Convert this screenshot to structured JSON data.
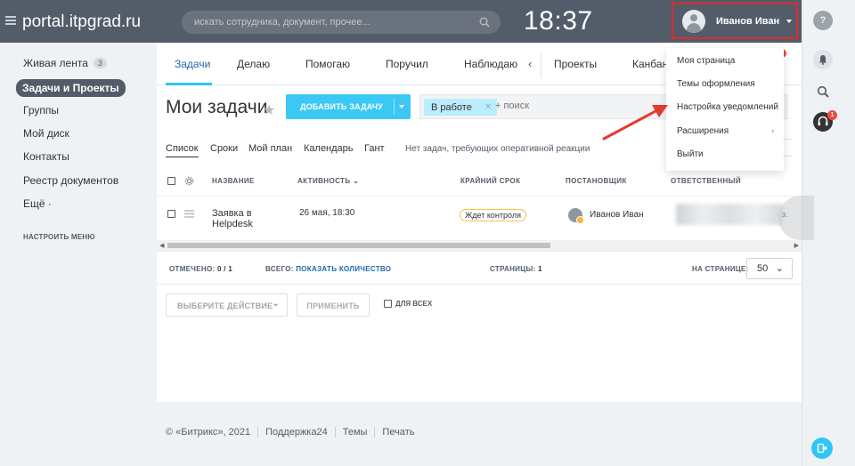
{
  "header": {
    "logo": "portal.itpgrad.ru",
    "search_placeholder": "искать сотрудника, документ, прочее...",
    "clock": "18:37",
    "user_name": "Иванов Иван"
  },
  "left_menu": {
    "items": [
      {
        "label": "Живая лента",
        "counter": "3"
      },
      {
        "label": "Задачи и Проекты"
      },
      {
        "label": "Группы"
      },
      {
        "label": "Мой диск"
      },
      {
        "label": "Контакты"
      },
      {
        "label": "Реестр документов"
      },
      {
        "label": "Ещё ·"
      }
    ],
    "settings": "НАСТРОИТЬ МЕНЮ"
  },
  "tabs": [
    "Задачи",
    "Делаю",
    "Помогаю",
    "Поручил",
    "Наблюдаю",
    "Проекты",
    "Канбан"
  ],
  "title": "Мои задачи",
  "add_button": "ДОБАВИТЬ ЗАДАЧУ",
  "filter": {
    "chip": "В работе",
    "placeholder": "+ поиск"
  },
  "subnav": {
    "items": [
      "Список",
      "Сроки",
      "Мой план",
      "Календарь",
      "Гант"
    ],
    "note": "Нет задач, требующих оперативной реакции"
  },
  "table": {
    "headers": {
      "name": "НАЗВАНИЕ",
      "activity": "АКТИВНОСТЬ",
      "deadline": "КРАЙНИЙ СРОК",
      "creator": "ПОСТАНОВЩИК",
      "responsible": "ОТВЕТСТВЕННЫЙ"
    },
    "rows": [
      {
        "name_line1": "Заявка в",
        "name_line2": "Helpdesk",
        "activity": "26 мая, 18:30",
        "status": "Ждет контроля",
        "creator": "Иванов Иван",
        "responsible_tail": "з."
      }
    ]
  },
  "footer_bar": {
    "marked_label": "ОТМЕЧЕНО:",
    "marked_value": "0 / 1",
    "total_label": "ВСЕГО:",
    "total_link": "ПОКАЗАТЬ КОЛИЧЕСТВО",
    "pages_label": "СТРАНИЦЫ:",
    "pages_value": "1",
    "per_page_label": "НА СТРАНИЦЕ:",
    "per_page_value": "50"
  },
  "actions": {
    "select": "ВЫБЕРИТЕ ДЕЙСТВИЕ",
    "apply": "ПРИМЕНИТЬ",
    "for_all": "ДЛЯ ВСЕХ"
  },
  "dropdown": {
    "items": [
      "Моя страница",
      "Темы оформления",
      "Настройка уведомлений",
      "Расширения",
      "Выйти"
    ]
  },
  "rightbar": {
    "help": "?",
    "badge": "1"
  },
  "page_footer": {
    "copyright": "© «Битрикс», 2021",
    "links": [
      "Поддержка24",
      "Темы",
      "Печать"
    ]
  },
  "colors": {
    "header_bg": "#535c69",
    "accent": "#2fc6f6",
    "highlight_border": "#e02b2b",
    "status_border": "#f1c34e"
  }
}
